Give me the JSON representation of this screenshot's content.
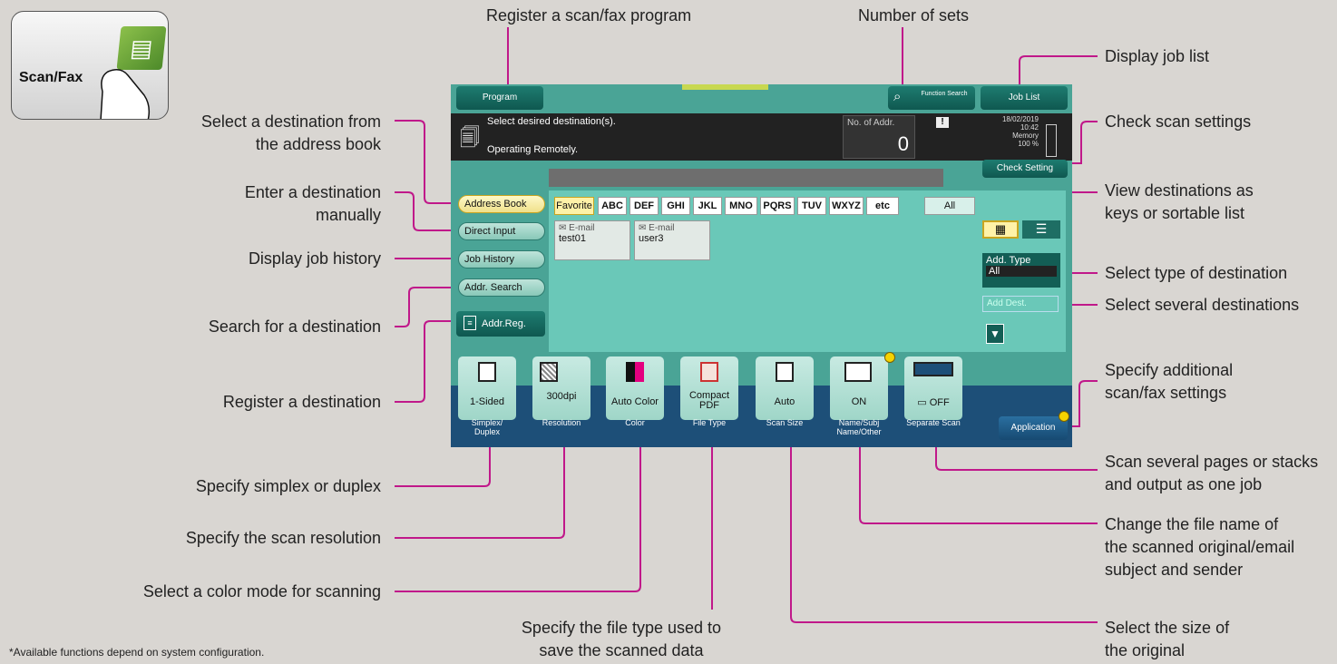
{
  "key": {
    "label": "Scan/Fax"
  },
  "top_callouts": {
    "program": "Register a scan/fax program",
    "sets": "Number of sets"
  },
  "left_callouts": {
    "addr_book": "Select a destination from\nthe address book",
    "direct": "Enter a destination\nmanually",
    "history": "Display job history",
    "search": "Search for a destination",
    "register": "Register a destination",
    "simplex": "Specify simplex or duplex",
    "resolution": "Specify the scan resolution",
    "color": "Select a color mode for scanning"
  },
  "bottom_callouts": {
    "filetype": "Specify the file type used to\nsave the scanned data",
    "size": "Select the size of\nthe original"
  },
  "right_callouts": {
    "joblist": "Display job list",
    "check": "Check scan settings",
    "view": "View destinations as\nkeys or sortable list",
    "type": "Select type of destination",
    "several": "Select several destinations",
    "additional": "Specify additional\nscan/fax settings",
    "stacks": "Scan several pages or stacks\nand output as one job",
    "filename": "Change the file name of\nthe scanned original/email\nsubject and sender"
  },
  "note": "*Available functions depend on system configuration.",
  "panel": {
    "program": "Program",
    "func_search": "Function Search",
    "job_list": "Job List",
    "msg1": "Select desired destination(s).",
    "msg2": "Operating Remotely.",
    "no_addr": "No. of Addr.",
    "count": "0",
    "date": "18/02/2019",
    "time": "10:42",
    "memory": "Memory",
    "mem_pct": "100 %",
    "check_setting": "Check Setting",
    "tabs": [
      "Address Book",
      "Direct Input",
      "Job History",
      "Addr. Search"
    ],
    "addr_reg": "Addr.Reg.",
    "alpha": [
      "Favorite",
      "ABC",
      "DEF",
      "GHI",
      "JKL",
      "MNO",
      "PQRS",
      "TUV",
      "WXYZ",
      "etc",
      "All"
    ],
    "dests": [
      {
        "type": "E-mail",
        "name": "test01"
      },
      {
        "type": "E-mail",
        "name": "user3"
      }
    ],
    "add_type": "Add. Type",
    "add_type_val": "All",
    "add_dest": "Add Dest.",
    "funcs": [
      {
        "value": "1-Sided",
        "label": "Simplex/ Duplex"
      },
      {
        "value": "300dpi",
        "label": "Resolution"
      },
      {
        "value": "Auto Color",
        "label": "Color"
      },
      {
        "value": "Compact PDF",
        "label": "File Type"
      },
      {
        "value": "Auto",
        "label": "Scan Size"
      },
      {
        "value": "ON",
        "label": "Name/Subj Name/Other"
      },
      {
        "value": "OFF",
        "label": "Separate Scan"
      }
    ],
    "application": "Application"
  }
}
